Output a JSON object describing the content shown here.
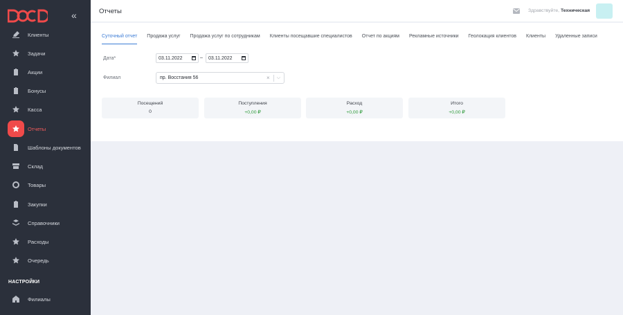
{
  "sidebar": {
    "items": [
      {
        "label": "Клиенты",
        "icon": "edit-icon"
      },
      {
        "label": "Задачи",
        "icon": "star-icon"
      },
      {
        "label": "Акции",
        "icon": "clipboard-icon"
      },
      {
        "label": "Бонусы",
        "icon": "clipboard-icon"
      },
      {
        "label": "Касса",
        "icon": "star-icon"
      },
      {
        "label": "Отчеты",
        "icon": "star-icon"
      },
      {
        "label": "Шаблоны документов",
        "icon": "document-icon"
      },
      {
        "label": "Склад",
        "icon": "box-icon"
      },
      {
        "label": "Товары",
        "icon": "circle-icon"
      },
      {
        "label": "Закупки",
        "icon": "clipboard-icon"
      },
      {
        "label": "Справочники",
        "icon": "layers-icon"
      },
      {
        "label": "Расходы",
        "icon": "star-icon"
      },
      {
        "label": "Очередь",
        "icon": "star-icon"
      }
    ],
    "section_title": "НАСТРОЙКИ",
    "settings_items": [
      {
        "label": "Филиалы",
        "icon": "home-icon"
      }
    ],
    "collapse_icon": "«"
  },
  "header": {
    "title": "Отчеты",
    "greeting": "Здравствуйте,",
    "user": "Техническая"
  },
  "tabs": [
    "Суточный отчет",
    "Продажа услуг",
    "Продажа услуг по сотрудникам",
    "Клиенты посещавшие специалистов",
    "Отчет по акциям",
    "Рекламные источники",
    "Геолокация клиентов",
    "Клиенты",
    "Удаленные записи"
  ],
  "filters": {
    "date_label": "Дата*",
    "date_from": "03.11.2022",
    "date_separator": "–",
    "date_to": "03.11.2022",
    "branch_label": "Филиал",
    "branch_value": "пр. Восстания 56",
    "branch_clear": "×",
    "branch_chevron": "⌵"
  },
  "summary": [
    {
      "title": "Посещений",
      "value": "0",
      "color": "#3c4048"
    },
    {
      "title": "Поступления",
      "value": "+0,00 ₽",
      "color": "#2e9a3a"
    },
    {
      "title": "Расход",
      "value": "+0,00 ₽",
      "color": "#2e9a3a"
    },
    {
      "title": "Итого",
      "value": "+0,00 ₽",
      "color": "#2e9a3a"
    }
  ],
  "colors": {
    "accent": "#f04a4a",
    "link": "#3a7bd5",
    "sidebar_bg": "#2b303b"
  }
}
